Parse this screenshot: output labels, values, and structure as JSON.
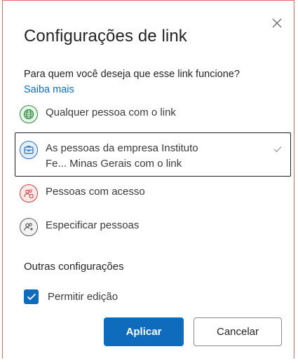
{
  "dialog": {
    "title": "Configurações de link",
    "question": "Para quem você deseja que esse link funcione?",
    "learn_more": "Saiba mais"
  },
  "options": [
    {
      "label": "Qualquer pessoa com o link",
      "icon": "globe-icon",
      "selected": false
    },
    {
      "label_line1": "As pessoas da empresa Instituto",
      "label_line2": "Fe... Minas Gerais com o link",
      "icon": "organization-icon",
      "selected": true
    },
    {
      "label": "Pessoas com acesso",
      "icon": "people-access-icon",
      "selected": false
    },
    {
      "label": "Especificar pessoas",
      "icon": "specific-people-icon",
      "selected": false
    }
  ],
  "other_settings": {
    "heading": "Outras configurações",
    "allow_edit_label": "Permitir edição",
    "allow_edit_checked": true
  },
  "buttons": {
    "apply": "Aplicar",
    "cancel": "Cancelar"
  },
  "colors": {
    "accent": "#0f6cbd",
    "globe": "#2e8b3c",
    "organization": "#2b6fb7",
    "people": "#c8423e"
  }
}
